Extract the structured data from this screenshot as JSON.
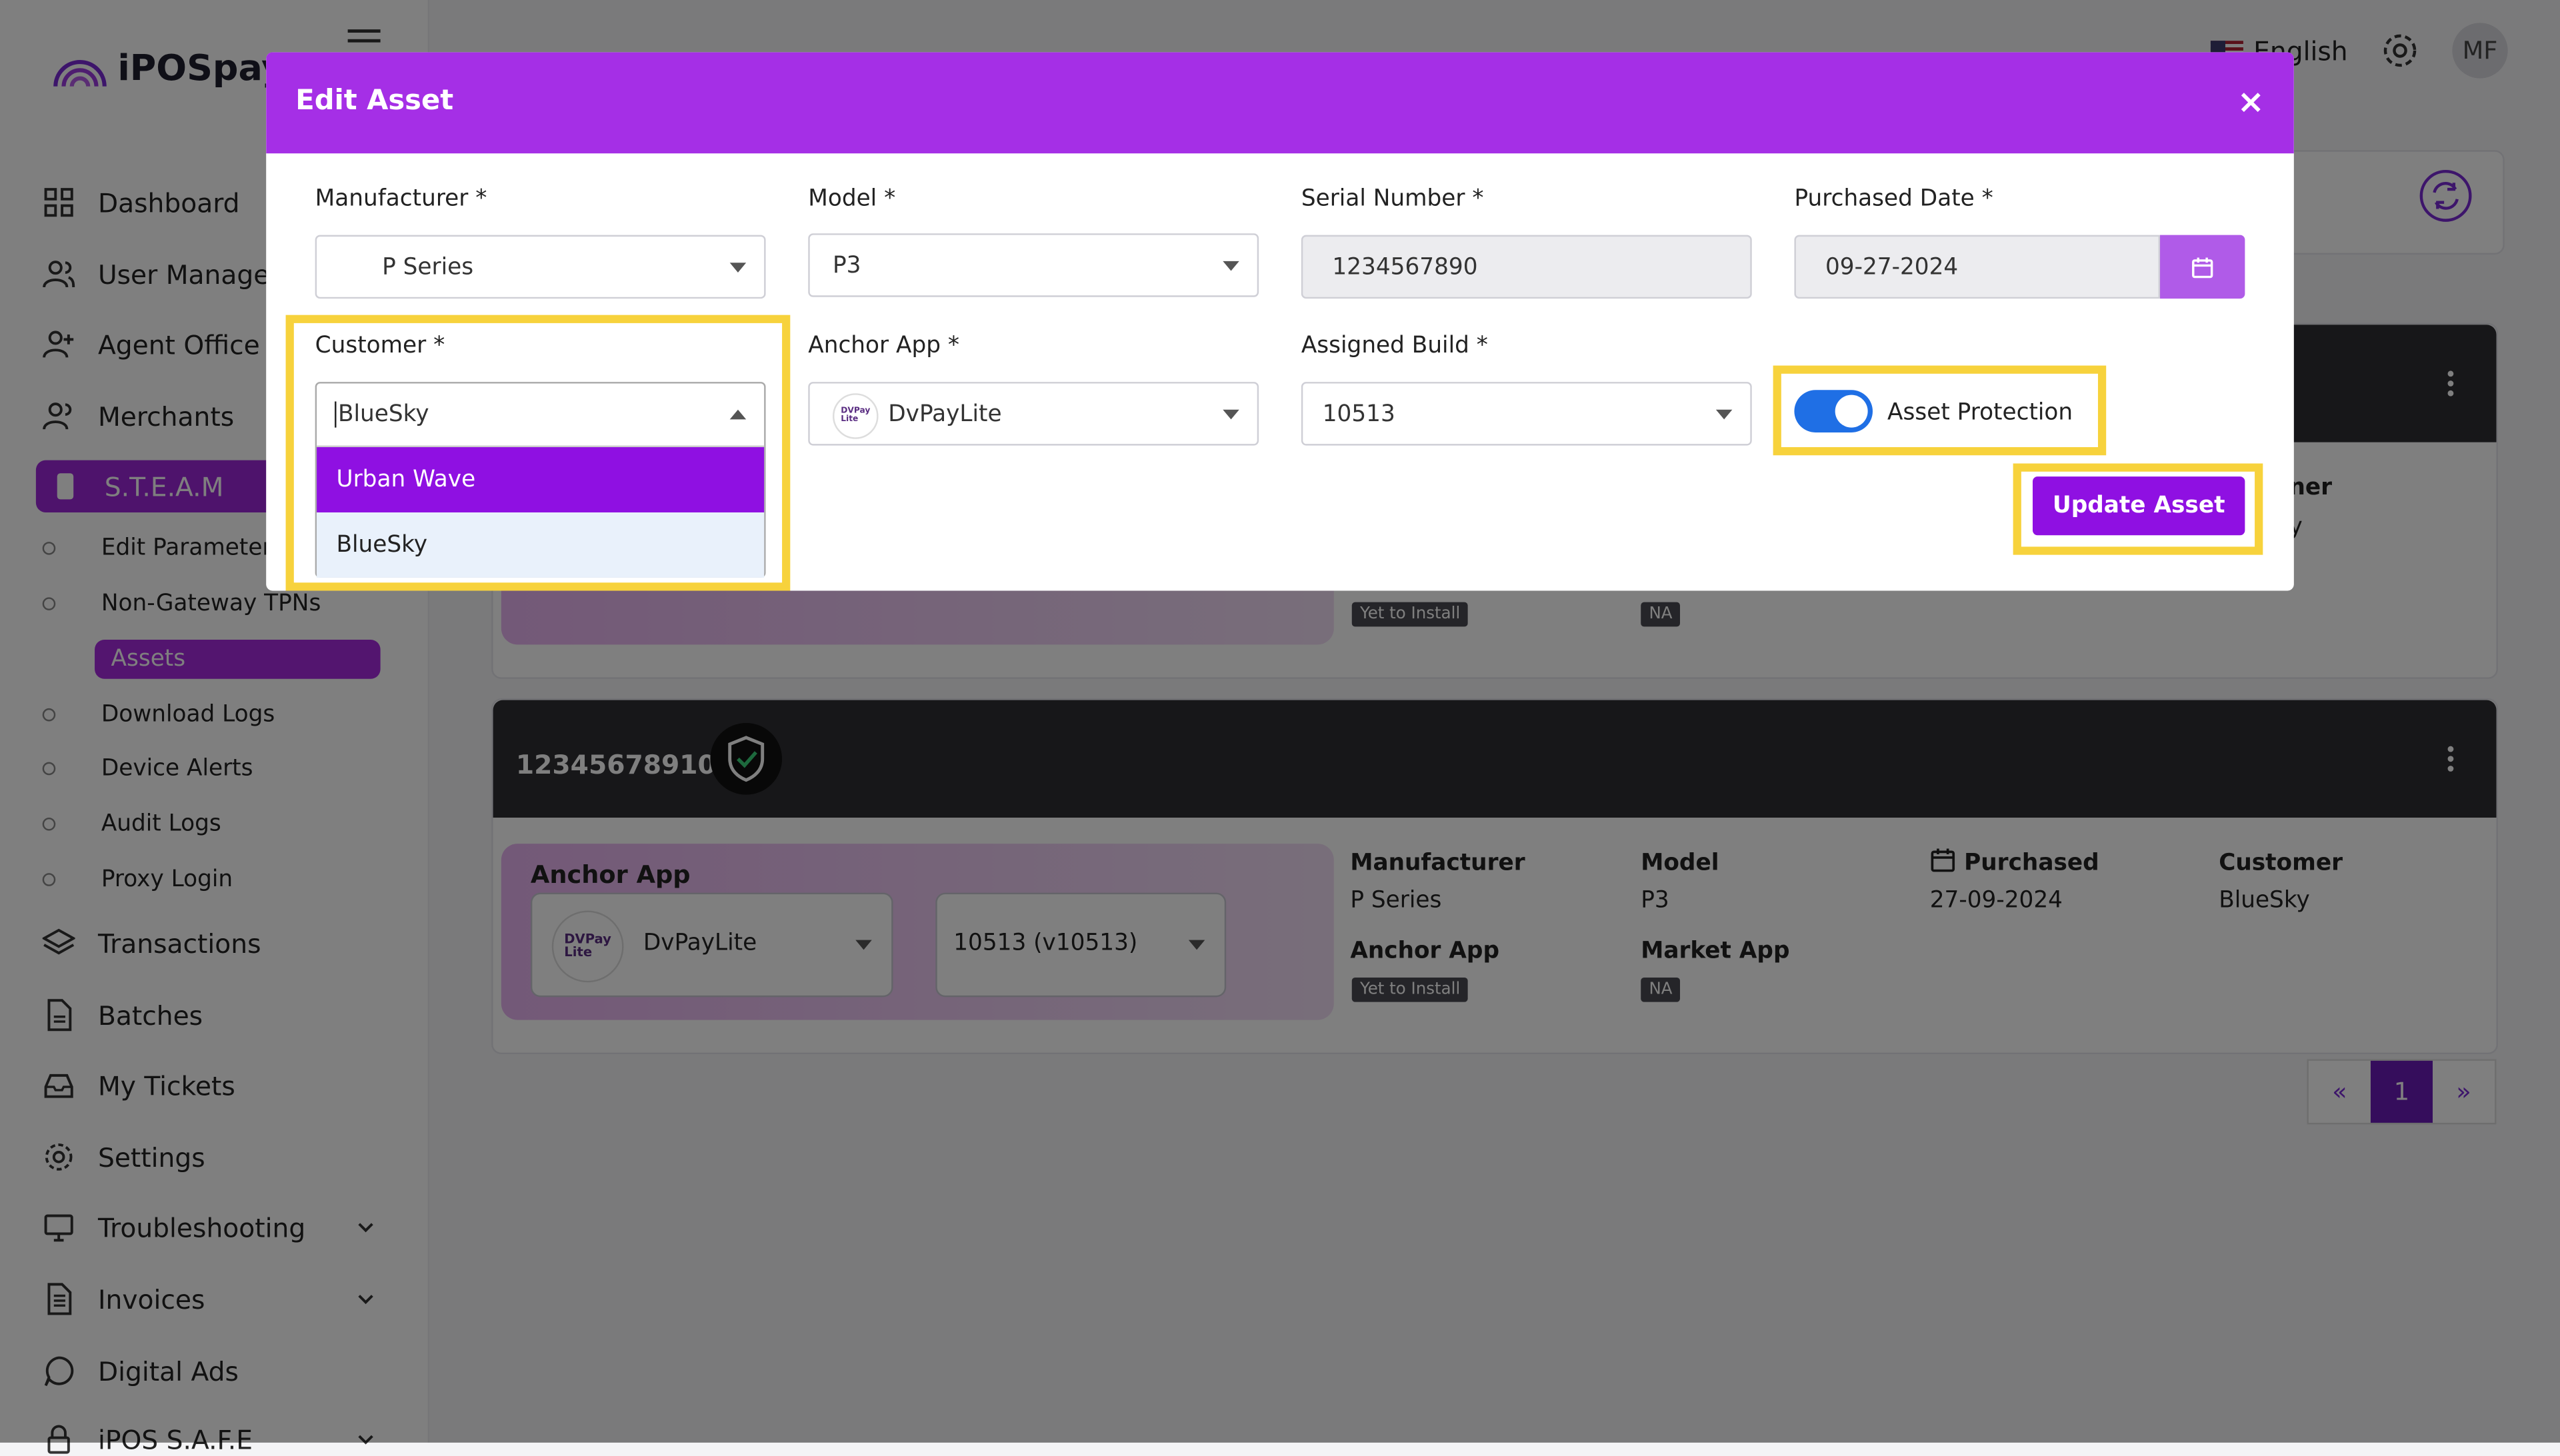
{
  "app": {
    "brand": "iPOSpay"
  },
  "topbar": {
    "language": "English",
    "avatar_initials": "MF"
  },
  "sidebar": {
    "items": [
      {
        "label": "Dashboard",
        "icon": "grid-icon"
      },
      {
        "label": "User Managem",
        "icon": "users-icon"
      },
      {
        "label": "Agent Office",
        "icon": "user-plus-icon"
      },
      {
        "label": "Merchants",
        "icon": "users-icon"
      },
      {
        "label": "S.T.E.A.M",
        "icon": "device-icon"
      }
    ],
    "sub_items": [
      "Edit Parameters",
      "Non-Gateway TPNs",
      "Assets",
      "Download Logs",
      "Device Alerts",
      "Audit Logs",
      "Proxy Login"
    ],
    "items_bottom": [
      {
        "label": "Transactions",
        "icon": "layers-icon"
      },
      {
        "label": "Batches",
        "icon": "file-icon"
      },
      {
        "label": "My Tickets",
        "icon": "inbox-icon"
      },
      {
        "label": "Settings",
        "icon": "gear-icon"
      },
      {
        "label": "Troubleshooting",
        "icon": "monitor-icon"
      },
      {
        "label": "Invoices",
        "icon": "document-icon"
      },
      {
        "label": "Digital Ads",
        "icon": "chat-icon"
      },
      {
        "label": "iPOS S.A.F.E",
        "icon": "lock-icon"
      }
    ]
  },
  "background": {
    "card1": {
      "partial_label": "ner",
      "partial_value": "y",
      "anchor_tag": "Yet to Install",
      "market_tag": "NA"
    },
    "card2": {
      "serial": "12345678910",
      "anchor_app_label": "Anchor App",
      "anchor_app_value": "DvPayLite",
      "build_value": "10513 (v10513)",
      "manufacturer_label": "Manufacturer",
      "manufacturer_value": "P Series",
      "model_label": "Model",
      "model_value": "P3",
      "purchased_label": "Purchased",
      "purchased_value": "27-09-2024",
      "customer_label": "Customer",
      "customer_value": "BlueSky",
      "anchor_label2": "Anchor App",
      "anchor_tag": "Yet to Install",
      "market_label": "Market App",
      "market_tag": "NA"
    },
    "pager": {
      "prev": "«",
      "page": "1",
      "next": "»"
    }
  },
  "modal": {
    "title": "Edit Asset",
    "close": "×",
    "fields": {
      "manufacturer": {
        "label": "Manufacturer *",
        "value": "P Series"
      },
      "model": {
        "label": "Model *",
        "value": "P3"
      },
      "serial": {
        "label": "Serial Number *",
        "value": "1234567890"
      },
      "purchased": {
        "label": "Purchased Date *",
        "value": "09-27-2024"
      },
      "customer": {
        "label": "Customer *",
        "value": "BlueSky",
        "options": [
          "Urban Wave",
          "BlueSky"
        ]
      },
      "anchor_app": {
        "label": "Anchor App *",
        "value": "DvPayLite"
      },
      "assigned_build": {
        "label": "Assigned Build *",
        "value": "10513"
      },
      "asset_protection": {
        "label": "Asset Protection",
        "enabled": true
      }
    },
    "submit_label": "Update Asset"
  },
  "colors": {
    "accent": "#a52fe6",
    "button": "#8f10e2",
    "highlight": "#f7d23c",
    "toggle": "#1f6fe5"
  }
}
